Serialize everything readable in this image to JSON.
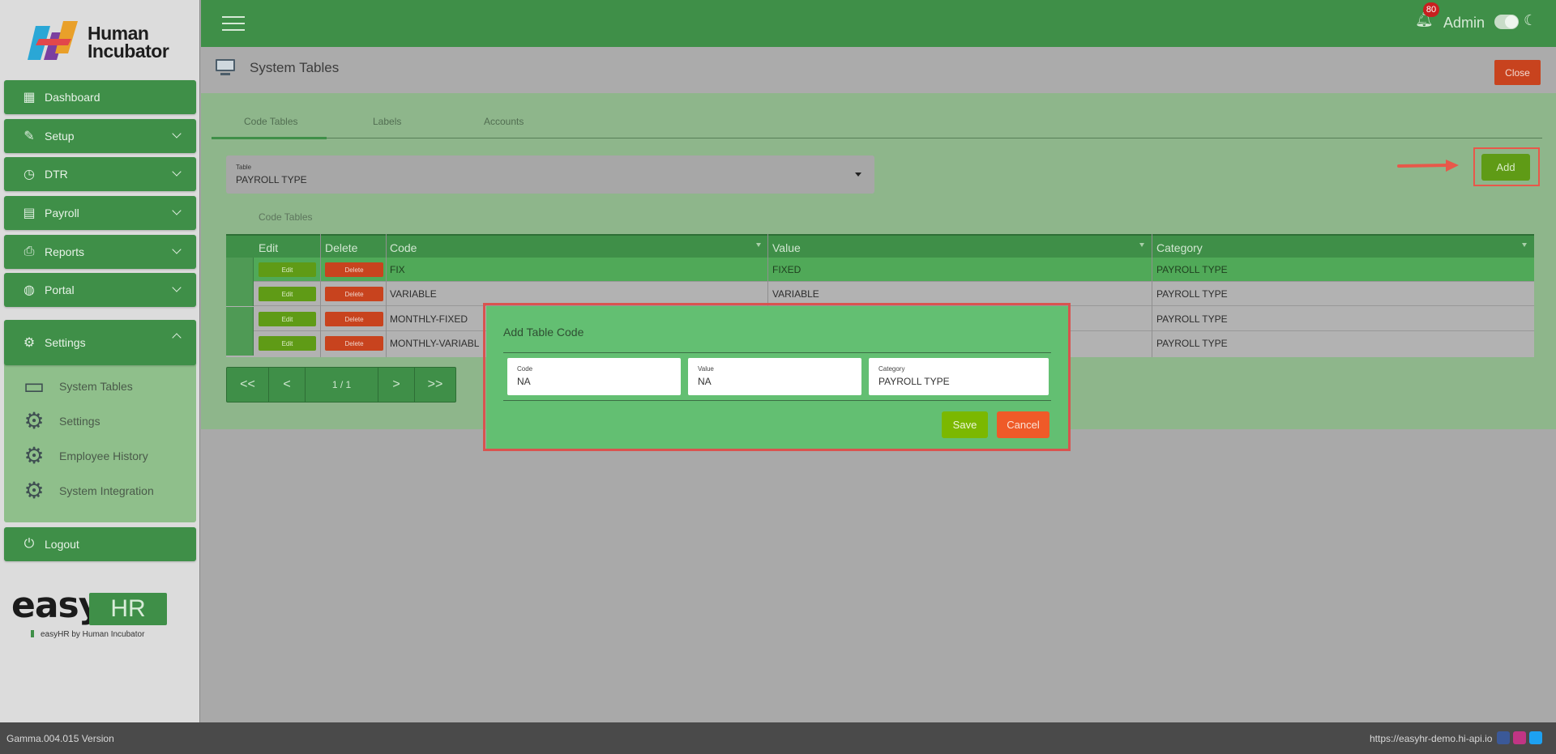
{
  "brand": {
    "logo_text_line1": "Human",
    "logo_text_line2": "Incubator",
    "easy_word": "easy",
    "hr_word": "HR",
    "easy_sub": "easyHR by Human Incubator"
  },
  "sidebar": {
    "items": [
      {
        "label": "Dashboard",
        "icon": "dashboard-icon"
      },
      {
        "label": "Setup",
        "icon": "wrench-icon"
      },
      {
        "label": "DTR",
        "icon": "clock-icon"
      },
      {
        "label": "Payroll",
        "icon": "payroll-icon"
      },
      {
        "label": "Reports",
        "icon": "printer-icon"
      },
      {
        "label": "Portal",
        "icon": "globe-icon"
      }
    ],
    "settings": {
      "label": "Settings",
      "sub_items": [
        "System Tables",
        "Settings",
        "Employee History",
        "System Integration"
      ]
    },
    "logout": "Logout"
  },
  "header": {
    "notification_count": "80",
    "user": "Admin"
  },
  "page": {
    "title": "System Tables",
    "close_label": "Close"
  },
  "tabs": [
    "Code Tables",
    "Labels",
    "Accounts"
  ],
  "table_select": {
    "label": "Table",
    "value": "PAYROLL TYPE"
  },
  "add_label": "Add",
  "section_caption": "Code Tables",
  "grid": {
    "headers": [
      "Edit",
      "Delete",
      "Code",
      "Value",
      "Category"
    ],
    "edit_label": "Edit",
    "delete_label": "Delete",
    "rows": [
      {
        "code": "FIX",
        "value": "FIXED",
        "category": "PAYROLL TYPE"
      },
      {
        "code": "VARIABLE",
        "value": "VARIABLE",
        "category": "PAYROLL TYPE"
      },
      {
        "code": "MONTHLY-FIXED",
        "value": "",
        "category": "PAYROLL TYPE"
      },
      {
        "code": "MONTHLY-VARIABL",
        "value": "",
        "category": "PAYROLL TYPE"
      }
    ]
  },
  "pager": {
    "first": "<<",
    "prev": "<",
    "label": "1 / 1",
    "next": ">",
    "last": ">>"
  },
  "modal": {
    "title": "Add Table Code",
    "code_label": "Code",
    "code_value": "NA",
    "value_label": "Value",
    "value_value": "NA",
    "category_label": "Category",
    "category_value": "PAYROLL TYPE",
    "save_label": "Save",
    "cancel_label": "Cancel"
  },
  "footer": {
    "version": "Gamma.004.015 Version",
    "url": "https://easyhr-demo.hi-api.io"
  },
  "colors": {
    "primary_green": "#3f8f48",
    "add_green": "#5f9b16",
    "delete_red": "#c8431e",
    "modal_green": "#63bf72",
    "highlight_red": "#e8584a"
  }
}
